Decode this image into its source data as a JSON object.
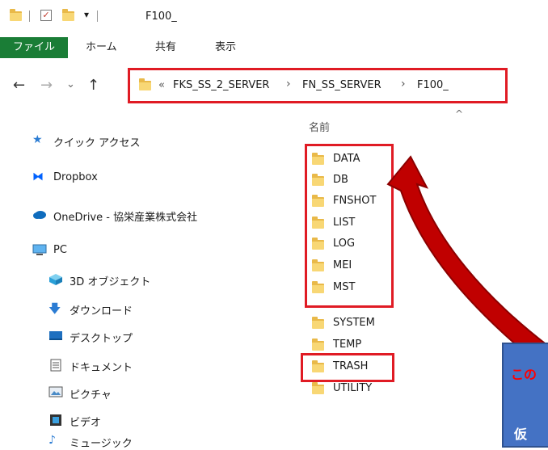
{
  "titlebar": {
    "title": "F100_"
  },
  "ribbon": {
    "tabs": [
      "ファイル",
      "ホーム",
      "共有",
      "表示"
    ]
  },
  "nav": {
    "back": "←",
    "forward": "→",
    "recent": "⌄",
    "up": "↑",
    "breadcrumb": [
      "FKS_SS_2_SERVER",
      "FN_SS_SERVER",
      "F100_"
    ],
    "overflow": "«",
    "separator": "›"
  },
  "sidebar": {
    "items": [
      {
        "label": "クイック アクセス",
        "icon": "star-icon"
      },
      {
        "label": "Dropbox",
        "icon": "dropbox-icon"
      },
      {
        "label": "OneDrive - 協栄産業株式会社",
        "icon": "cloud-icon"
      },
      {
        "label": "PC",
        "icon": "pc-icon"
      },
      {
        "label": "3D オブジェクト",
        "icon": "cube-icon"
      },
      {
        "label": "ダウンロード",
        "icon": "download-icon"
      },
      {
        "label": "デスクトップ",
        "icon": "desktop-icon"
      },
      {
        "label": "ドキュメント",
        "icon": "document-icon"
      },
      {
        "label": "ピクチャ",
        "icon": "picture-icon"
      },
      {
        "label": "ビデオ",
        "icon": "video-icon"
      },
      {
        "label": "ミュージック",
        "icon": "music-icon"
      }
    ]
  },
  "main": {
    "column_header": "名前",
    "files": [
      "DATA",
      "DB",
      "FNSHOT",
      "LIST",
      "LOG",
      "MEI",
      "MST",
      "SYSTEM",
      "TEMP",
      "TRASH",
      "UTILITY"
    ]
  },
  "callout": {
    "line1": "この",
    "line2": "仮"
  },
  "colors": {
    "highlight": "#e01b24",
    "arrow": "#c00000",
    "callout": "#4472c4",
    "file_tab": "#1a7d36"
  }
}
